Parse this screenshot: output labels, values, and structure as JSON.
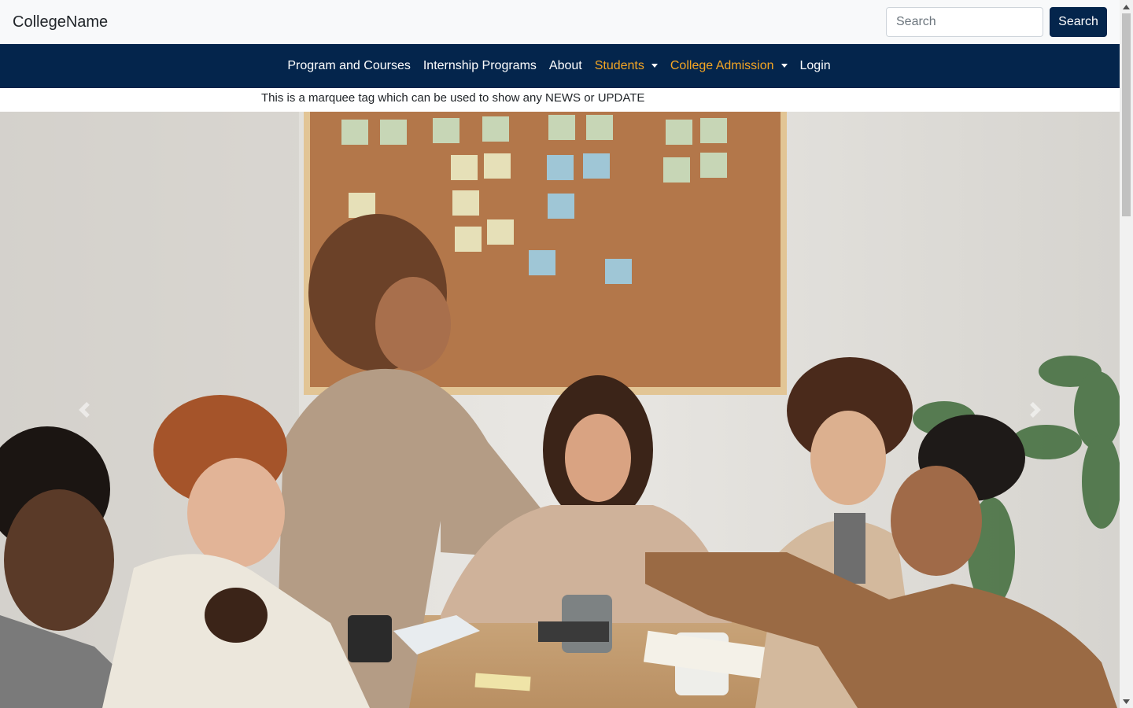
{
  "header": {
    "brand": "CollegeName",
    "search": {
      "placeholder": "Search",
      "value": "",
      "button_label": "Search"
    }
  },
  "nav": {
    "items": [
      {
        "label": "Program and Courses",
        "dropdown": false,
        "highlight": false
      },
      {
        "label": "Internship Programs",
        "dropdown": false,
        "highlight": false
      },
      {
        "label": "About",
        "dropdown": false,
        "highlight": false
      },
      {
        "label": "Students",
        "dropdown": true,
        "highlight": true
      },
      {
        "label": "College Admission",
        "dropdown": true,
        "highlight": true
      },
      {
        "label": "Login",
        "dropdown": false,
        "highlight": false
      }
    ]
  },
  "marquee": {
    "text": "This is a marquee tag which can be used to show any NEWS or UPDATE"
  },
  "carousel": {
    "prev_icon": "chevron-left-icon",
    "next_icon": "chevron-right-icon"
  },
  "colors": {
    "nav_background": "#04254c",
    "highlight": "#f5a623",
    "topbar_background": "#f8f9fa"
  }
}
